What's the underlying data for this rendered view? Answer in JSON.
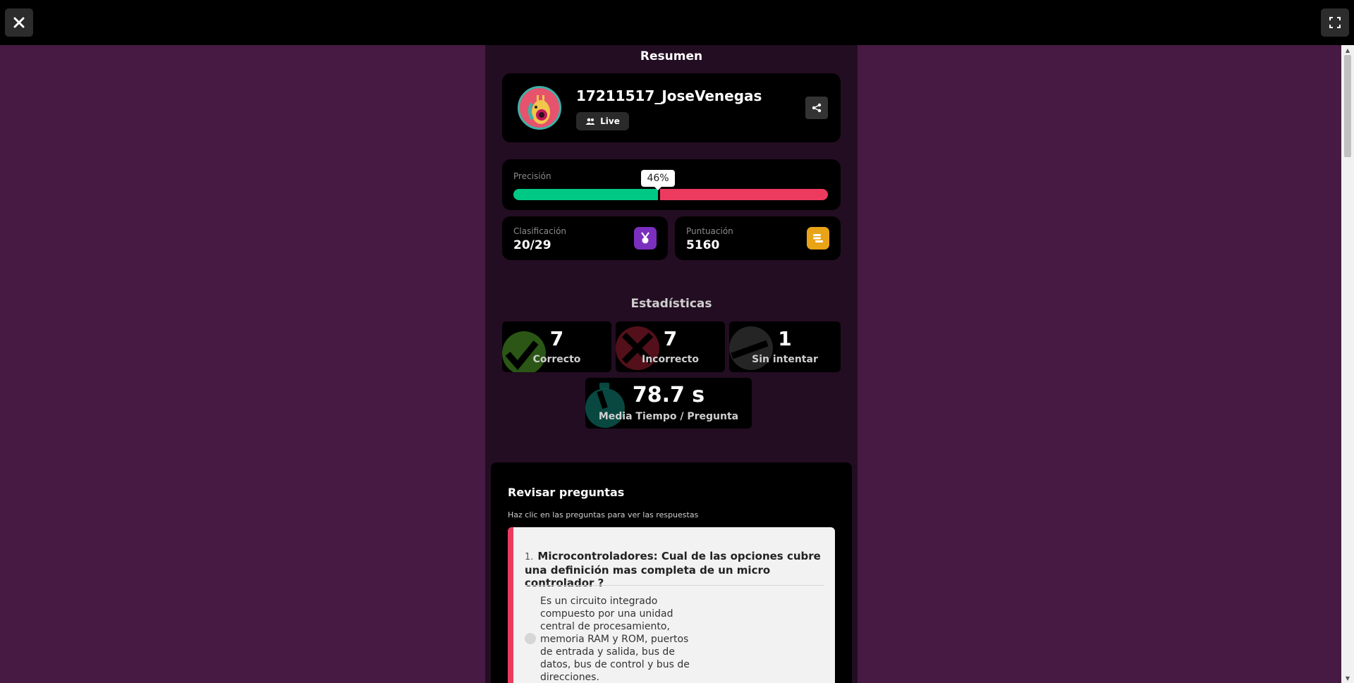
{
  "summary": {
    "title": "Resumen"
  },
  "profile": {
    "username": "17211517_JoseVenegas",
    "mode": "Live"
  },
  "accuracy": {
    "label": "Precisión",
    "percent_label": "46%",
    "value": 0.46
  },
  "rank": {
    "label": "Clasificación",
    "value": "20/29"
  },
  "score": {
    "label": "Puntuación",
    "value": "5160"
  },
  "stats": {
    "heading": "Estadísticas",
    "correct": {
      "value": "7",
      "label": "Correcto"
    },
    "incorrect": {
      "value": "7",
      "label": "Incorrecto"
    },
    "unattempted": {
      "value": "1",
      "label": "Sin intentar"
    },
    "avg_time": {
      "value": "78.7 s",
      "label": "Media Tiempo / Pregunta"
    }
  },
  "review": {
    "title": "Revisar preguntas",
    "subtitle": "Haz clic en las preguntas para ver las respuestas",
    "questions": [
      {
        "number": "1.",
        "text": "Microcontroladores: Cual de las opciones cubre una definición mas completa de un micro controlador ?",
        "options": [
          "Es un circuito integrado compuesto por una unidad central de procesamiento, memoria RAM y ROM, puertos de entrada y salida, bus de datos, bus de control y bus de direcciones."
        ]
      }
    ]
  },
  "colors": {
    "background": "#461a42",
    "panel": "#230d22",
    "correct": "#00c985",
    "incorrect": "#ec3b5e",
    "rank_icon": "#7b2fbf",
    "score_icon": "#e8a317"
  },
  "icons": {
    "close": "close-icon",
    "fullscreen": "fullscreen-icon",
    "share": "share-icon",
    "live": "people-icon",
    "rank": "medal-icon",
    "score": "coins-icon",
    "correct": "check-icon",
    "incorrect": "x-icon",
    "unattempted": "dash-icon",
    "time": "stopwatch-icon"
  }
}
